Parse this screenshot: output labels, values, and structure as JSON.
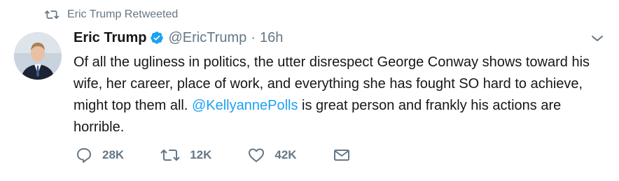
{
  "retweet": {
    "label": "Eric Trump Retweeted"
  },
  "tweet": {
    "author_name": "Eric Trump",
    "handle": "@EricTrump",
    "separator": "·",
    "time": "16h",
    "text_before": "Of all the ugliness in politics, the utter disrespect George Conway shows toward his wife, her career, place of work, and everything she has fought SO hard to achieve, might top them all. ",
    "mention": "@KellyannePolls",
    "text_after": " is great person and frankly his actions are horrible."
  },
  "actions": {
    "reply_count": "28K",
    "retweet_count": "12K",
    "like_count": "42K"
  },
  "colors": {
    "accent": "#1da1f2",
    "muted": "#657786",
    "text": "#14171a"
  }
}
